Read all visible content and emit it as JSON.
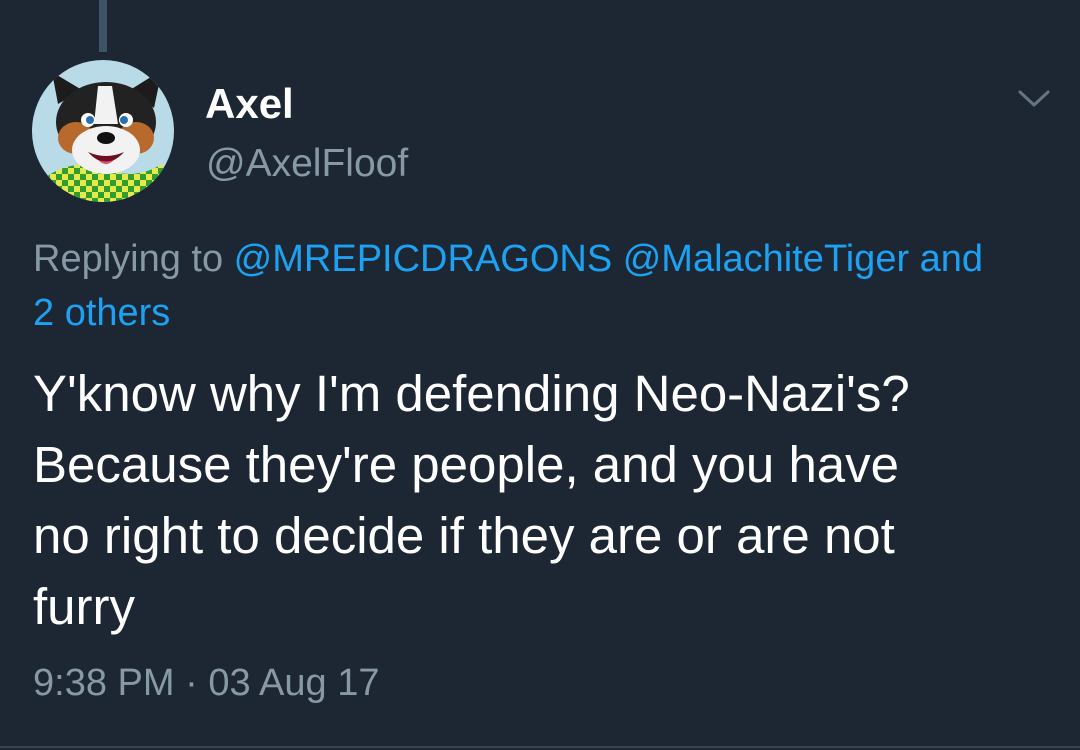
{
  "tweet": {
    "display_name": "Axel",
    "handle": "@AxelFloof",
    "replying_prefix": "Replying to ",
    "mentions": [
      "@MREPICDRAGONS",
      "@MalachiteTiger"
    ],
    "connector": " and",
    "others": "2 others",
    "text_lines": [
      "Y'know why I'm defending Neo-Nazi's?",
      "Because they're people, and you have",
      "no right to decide if they are or are not",
      "furry"
    ],
    "time": "9:38 PM",
    "separator": " · ",
    "date": "03 Aug 17"
  },
  "icons": {
    "menu": "chevron-down-icon",
    "avatar": "dog-avatar"
  },
  "colors": {
    "background": "#1c2733",
    "text": "#ffffff",
    "secondary": "#8899a6",
    "link": "#1da1f2"
  }
}
